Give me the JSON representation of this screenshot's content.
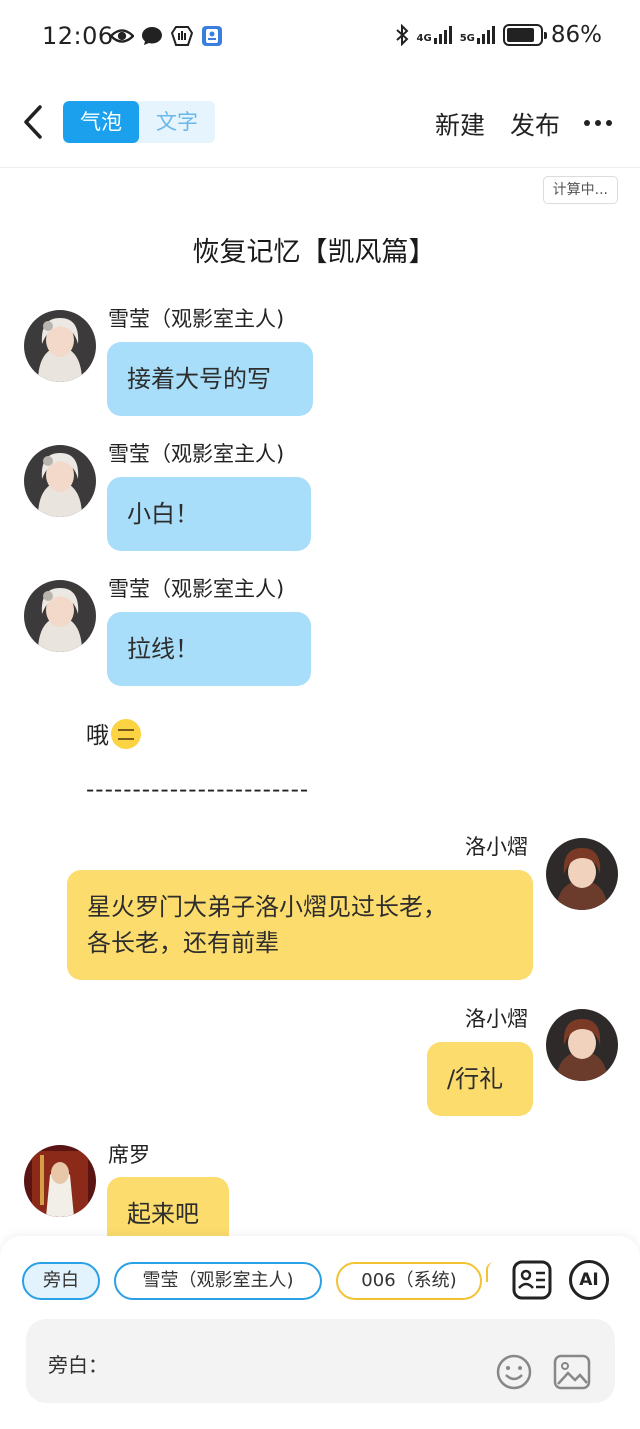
{
  "status_bar": {
    "time": "12:06",
    "left_icons": [
      "eye-icon",
      "chat-bubble-icon",
      "shield-hand-icon",
      "contact-card-icon"
    ],
    "network_labels": [
      "4G",
      "5G"
    ],
    "battery_percent": "86%",
    "battery_level": 0.86
  },
  "header": {
    "tabs": [
      {
        "label": "气泡",
        "active": true
      },
      {
        "label": "文字",
        "active": false
      }
    ],
    "new_label": "新建",
    "publish_label": "发布"
  },
  "calc_badge": "计算中...",
  "story_title": "恢复记忆【凯风篇】",
  "messages": [
    {
      "sender": "雪莹（观影室主人)",
      "text": "接着大号的写",
      "side": "left",
      "color": "#a8def9"
    },
    {
      "sender": "雪莹（观影室主人)",
      "text": "小白！",
      "side": "left",
      "color": "#a8def9"
    },
    {
      "sender": "雪莹（观影室主人)",
      "text": "拉线！",
      "side": "left",
      "color": "#a8def9"
    },
    {
      "narration": "哦",
      "emoji": "expressionless-face-icon"
    },
    {
      "narration": "------------------------"
    },
    {
      "sender": "洛小熠",
      "text_line1": "星火罗门大弟子洛小熠见过长老，",
      "text_line2": "各长老，还有前辈",
      "side": "right",
      "color": "#fcdc6c"
    },
    {
      "sender": "洛小熠",
      "text": "/行礼",
      "side": "right",
      "color": "#fcdc6c"
    },
    {
      "sender": "席罗",
      "text": "起来吧",
      "side": "left",
      "color": "#fcdc6c"
    }
  ],
  "role_chips": [
    "旁白",
    "雪莹（观影室主人)",
    "006（系统)"
  ],
  "tools": [
    "role-card-icon",
    "ai-icon"
  ],
  "ai_label": "AI",
  "input": {
    "label": "旁白：",
    "icons": [
      "emoji-icon",
      "image-icon"
    ]
  }
}
